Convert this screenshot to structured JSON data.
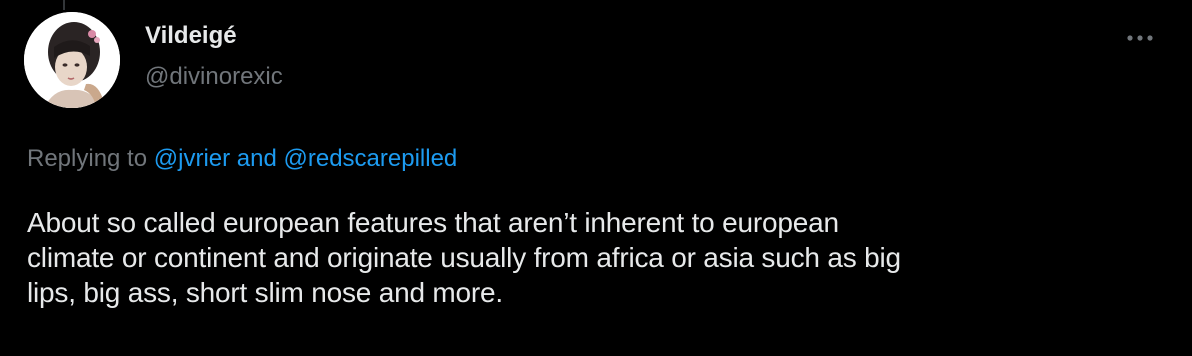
{
  "colors": {
    "background": "#000000",
    "primary_text": "#e7e9ea",
    "secondary_text": "#71767b",
    "link": "#1d9bf0"
  },
  "tweet": {
    "author": {
      "display_name": "Vildeigé",
      "handle": "@divinorexic",
      "avatar_icon": "profile-photo"
    },
    "more_icon": "more-dots-icon",
    "reply_context": {
      "prefix": "Replying to",
      "mention_1": "@jvrier",
      "joiner": "and",
      "mention_2": "@redscarepilled"
    },
    "text": "About so called european features that aren’t inherent to european\nclimate or continent  and originate usually from africa or asia such as big\nlips, big ass, short slim nose and more."
  }
}
